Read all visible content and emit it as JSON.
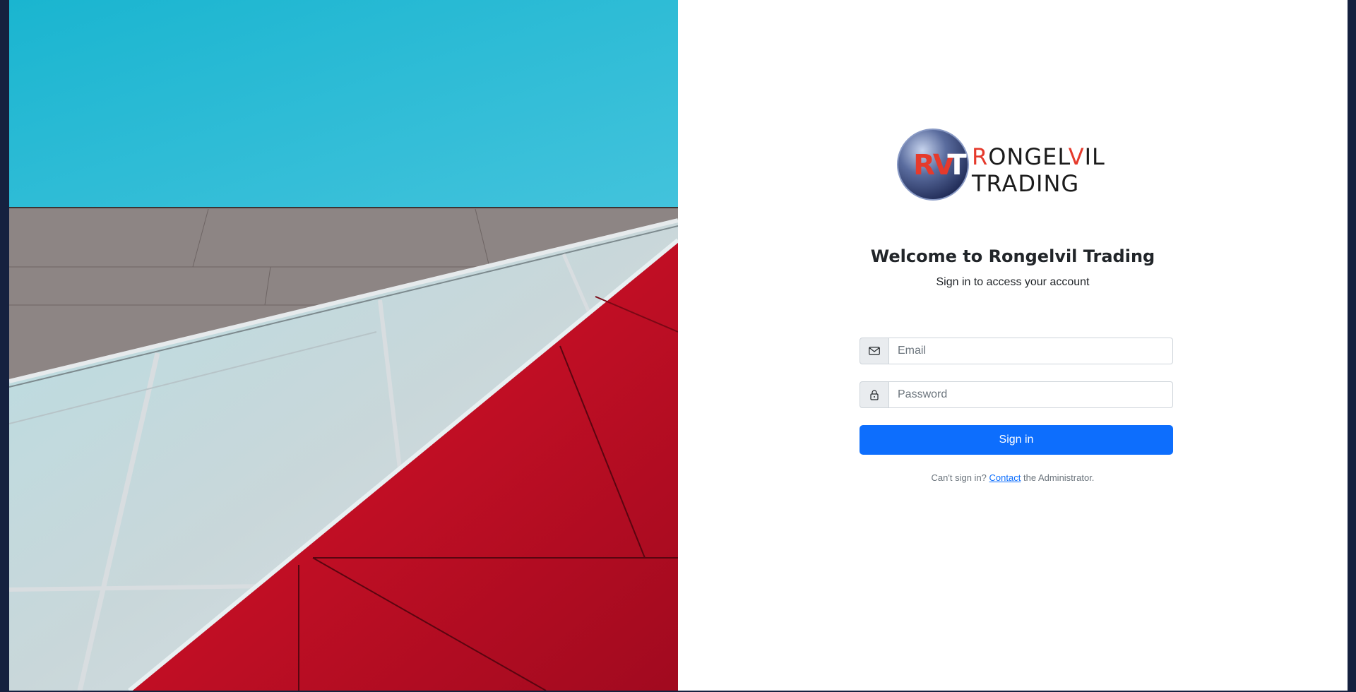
{
  "brand": {
    "logo_initials": "RVT",
    "wordmark_line1": "RONGELVIL",
    "wordmark_line2": "TRADING"
  },
  "header": {
    "title": "Welcome to Rongelvil Trading",
    "subtitle": "Sign in to access your account"
  },
  "form": {
    "email": {
      "value": "",
      "placeholder": "Email",
      "icon": "envelope-icon"
    },
    "password": {
      "value": "",
      "placeholder": "Password",
      "icon": "lock-icon"
    },
    "submit_label": "Sign in"
  },
  "help": {
    "prefix": "Can't sign in?",
    "link_text": "Contact",
    "suffix": "the Administrator."
  },
  "colors": {
    "primary": "#0d6efd",
    "accent_red": "#e53a2c",
    "sky": "#25b6d2",
    "background": "#15213f"
  }
}
